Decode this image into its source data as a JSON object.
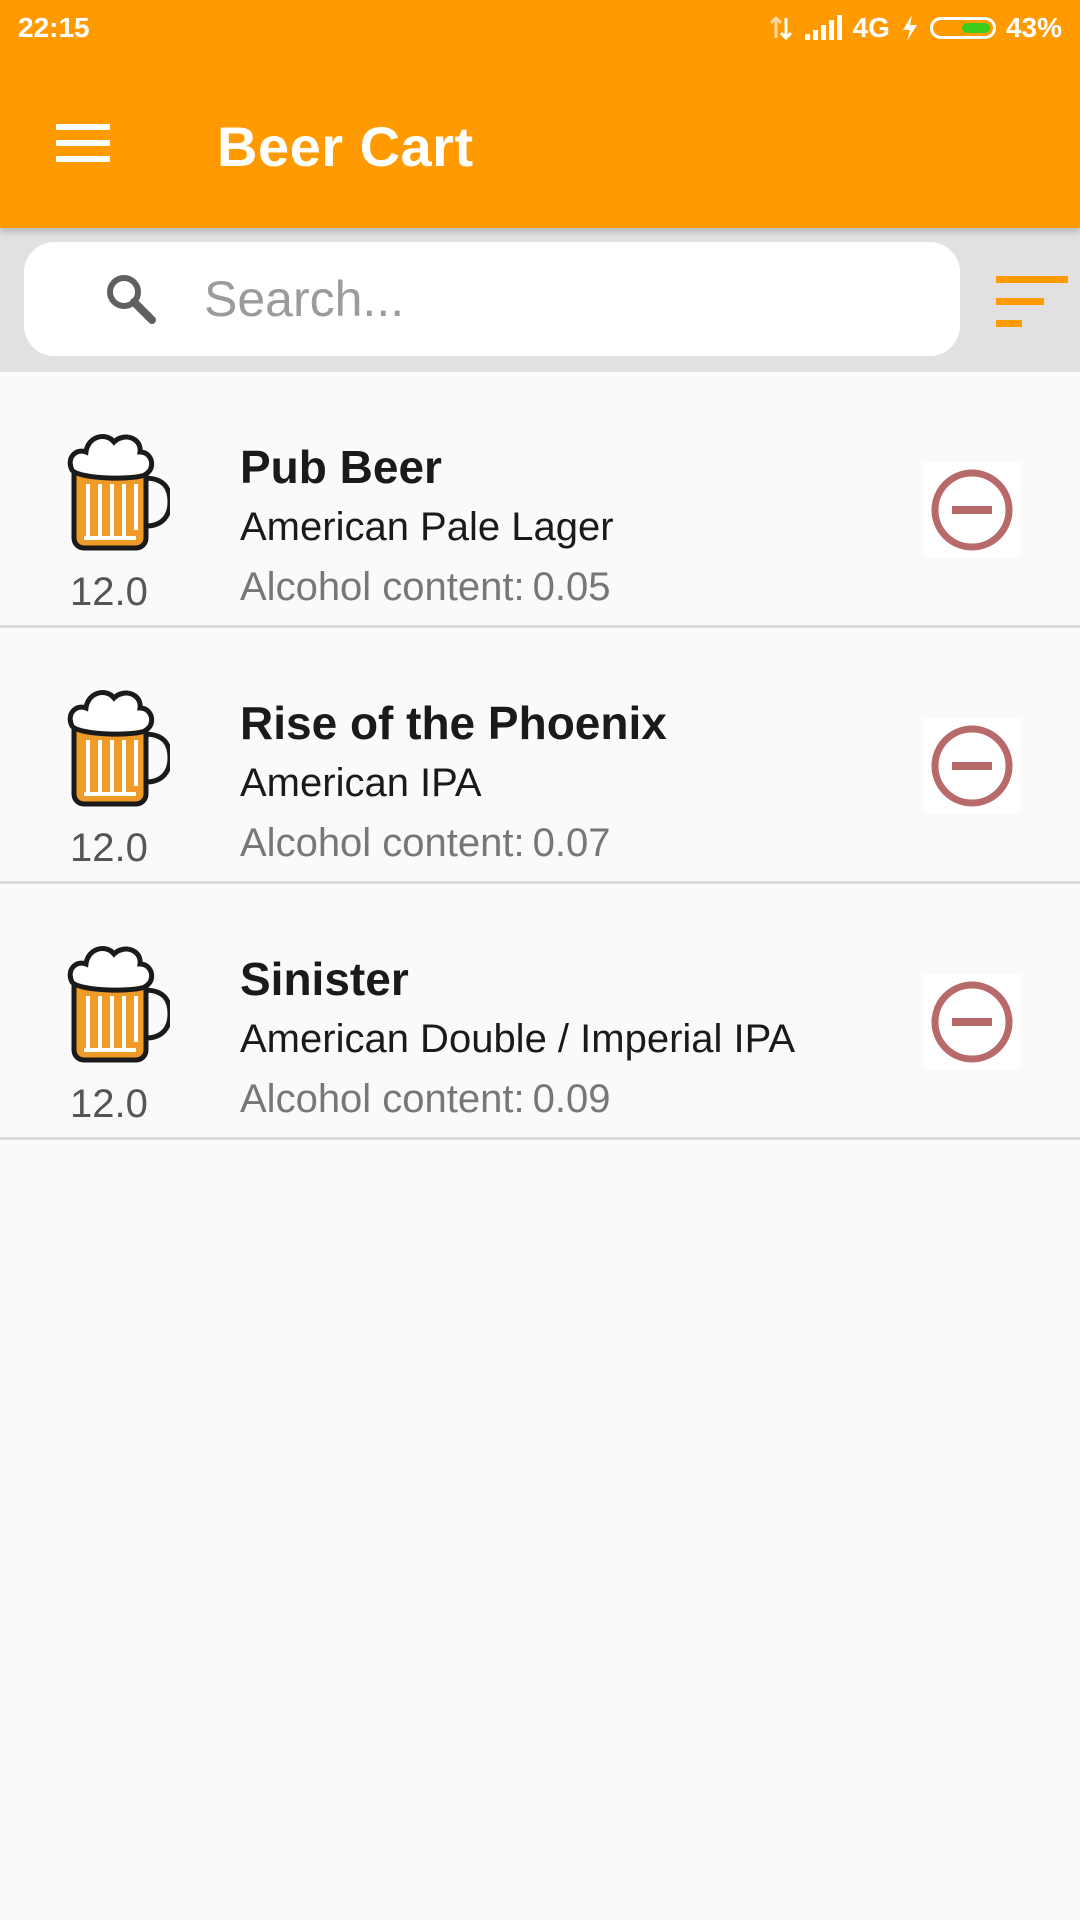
{
  "status_bar": {
    "time": "22:15",
    "network": "4G",
    "battery": "43%"
  },
  "appbar": {
    "title": "Beer Cart",
    "color": "#ff9a00"
  },
  "search": {
    "placeholder": "Search..."
  },
  "items": [
    {
      "name": "Pub Beer",
      "style": "American Pale Lager",
      "abv_label": "Alcohol content:",
      "abv": "0.05",
      "volume": "12.0"
    },
    {
      "name": "Rise of the Phoenix",
      "style": "American IPA",
      "abv_label": "Alcohol content:",
      "abv": "0.07",
      "volume": "12.0"
    },
    {
      "name": "Sinister",
      "style": "American Double / Imperial IPA",
      "abv_label": "Alcohol content:",
      "abv": "0.09",
      "volume": "12.0"
    }
  ],
  "icons": {
    "menu": "menu-icon",
    "search": "search-icon",
    "sort": "sort-icon",
    "beer": "beer-mug-icon",
    "remove": "remove-circle-icon"
  },
  "colors": {
    "accent": "#ff9a00",
    "remove": "#b86a6a"
  }
}
